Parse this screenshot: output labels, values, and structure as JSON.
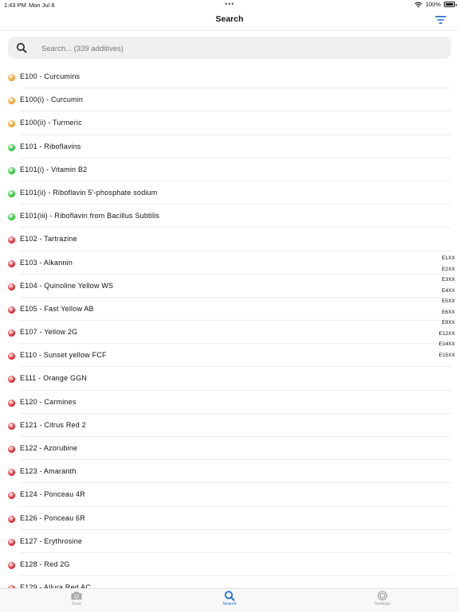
{
  "status": {
    "time": "1:43 PM",
    "date": "Mon Jul 8",
    "battery": "100%"
  },
  "nav": {
    "title": "Search"
  },
  "search": {
    "placeholder": "Search... (339 additives)"
  },
  "colors": {
    "orange": "#f29a1c",
    "green": "#1ec42e",
    "red": "#e0202a",
    "accent": "#1a6fd6"
  },
  "items": [
    {
      "label": "E100 - Curcumins",
      "status": "orange"
    },
    {
      "label": "E100(i) - Curcumin",
      "status": "orange"
    },
    {
      "label": "E100(ii) - Turmeric",
      "status": "orange"
    },
    {
      "label": "E101 - Riboflavins",
      "status": "green"
    },
    {
      "label": "E101(i) - Vitamin B2",
      "status": "green"
    },
    {
      "label": "E101(ii) - Riboflavin 5'-phosphate sodium",
      "status": "green"
    },
    {
      "label": "E101(iii) - Riboflavin from Bacillus Subtilis",
      "status": "green"
    },
    {
      "label": "E102 - Tartrazine",
      "status": "red"
    },
    {
      "label": "E103 - Alkannin",
      "status": "red"
    },
    {
      "label": "E104 - Quinoline Yellow WS",
      "status": "red"
    },
    {
      "label": "E105 - Fast Yellow AB",
      "status": "red"
    },
    {
      "label": "E107 - Yellow 2G",
      "status": "red"
    },
    {
      "label": "E110 - Sunset yellow FCF",
      "status": "red"
    },
    {
      "label": "E111 - Orange GGN",
      "status": "red"
    },
    {
      "label": "E120 - Carmines",
      "status": "red"
    },
    {
      "label": "E121 - Citrus Red 2",
      "status": "red"
    },
    {
      "label": "E122 - Azorubine",
      "status": "red"
    },
    {
      "label": "E123 - Amaranth",
      "status": "red"
    },
    {
      "label": "E124 - Ponceau 4R",
      "status": "red"
    },
    {
      "label": "E126 - Ponceau 6R",
      "status": "red"
    },
    {
      "label": "E127 - Erythrosine",
      "status": "red"
    },
    {
      "label": "E128 - Red 2G",
      "status": "red"
    },
    {
      "label": "E129 - Allura Red AC",
      "status": "red"
    }
  ],
  "index": [
    "E1XX",
    "E2XX",
    "E3XX",
    "E4XX",
    "E5XX",
    "E6XX",
    "E9XX",
    "E12XX",
    "E14XX",
    "E15XX"
  ],
  "tabs": {
    "scan": "Scan",
    "search": "Search",
    "settings": "Settings",
    "active": "search"
  }
}
